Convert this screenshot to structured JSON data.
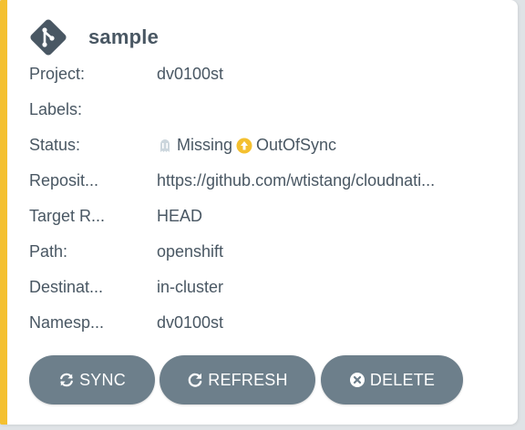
{
  "app": {
    "name": "sample",
    "icon": "git-branch-diamond-icon"
  },
  "fields": {
    "project": {
      "label": "Project:",
      "value": "dv0100st"
    },
    "labels": {
      "label": "Labels:",
      "value": ""
    },
    "status": {
      "label": "Status:",
      "health": "Missing",
      "health_icon": "ghost-icon",
      "sync": "OutOfSync",
      "sync_icon": "arrow-up-circle-icon",
      "sync_color": "#f4c030",
      "health_color": "#ccd6dd"
    },
    "repository": {
      "label": "Reposit...",
      "value": "https://github.com/wtistang/cloudnati..."
    },
    "target_revision": {
      "label": "Target R...",
      "value": "HEAD"
    },
    "path": {
      "label": "Path:",
      "value": "openshift"
    },
    "destination": {
      "label": "Destinat...",
      "value": "in-cluster"
    },
    "namespace": {
      "label": "Namesp...",
      "value": "dv0100st"
    }
  },
  "actions": {
    "sync": {
      "label": "SYNC",
      "icon": "sync-icon"
    },
    "refresh": {
      "label": "REFRESH",
      "icon": "redo-icon"
    },
    "delete": {
      "label": "DELETE",
      "icon": "times-circle-icon"
    }
  },
  "colors": {
    "accent": "#f4c030",
    "button_bg": "#6d7f8b",
    "text": "#495763"
  }
}
